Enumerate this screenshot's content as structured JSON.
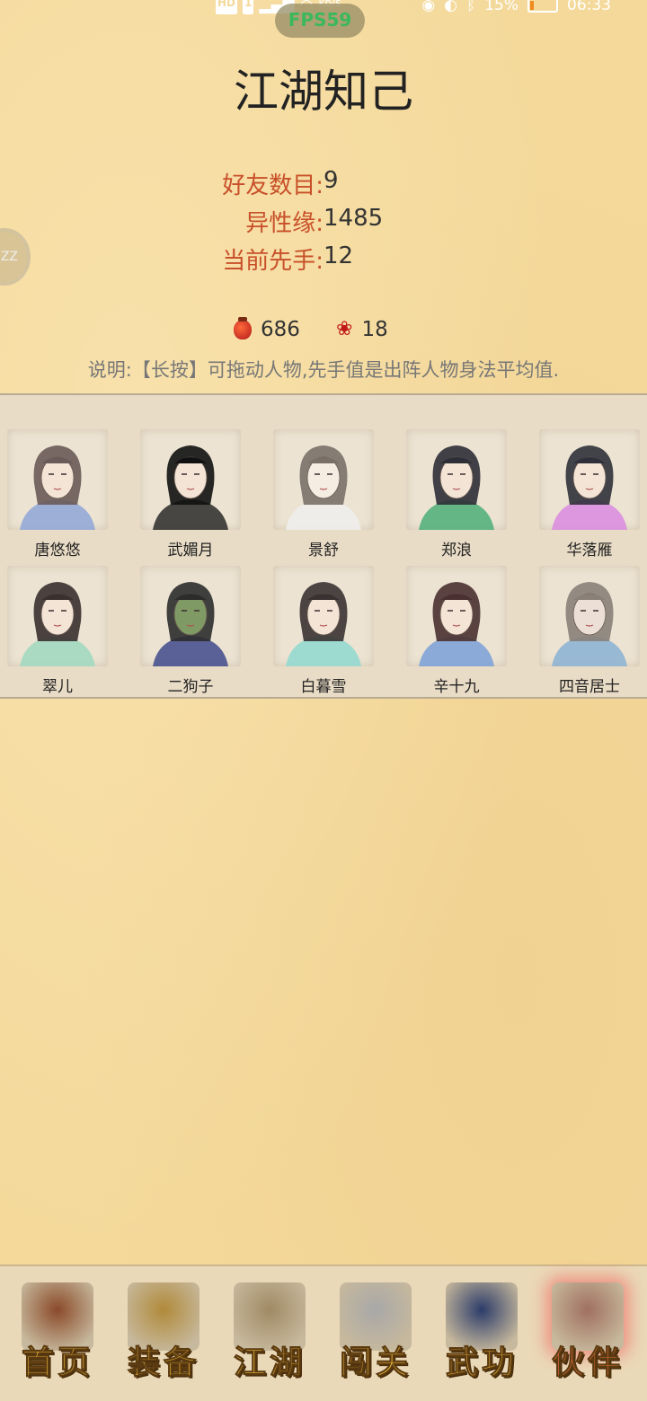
{
  "status_bar": {
    "left_badges": [
      "HD",
      "1"
    ],
    "wifi_label": "kb/s",
    "battery_percent": "15%",
    "battery_level": 0.15,
    "time": "06:33"
  },
  "fps_label": "FPS59",
  "float_ball_label": "ZZ",
  "title": "江湖知己",
  "stats": [
    {
      "label": "好友数目:",
      "value": "9"
    },
    {
      "label": "异性缘:",
      "value": "1485"
    },
    {
      "label": "当前先手:",
      "value": "12"
    }
  ],
  "resources": {
    "jar": {
      "icon": "wine-jar-icon",
      "count": "686"
    },
    "rose": {
      "icon": "rose-icon",
      "count": "18"
    }
  },
  "description": "说明:【长按】可拖动人物,先手值是出阵人物身法平均值.",
  "companions": [
    {
      "name": "唐悠悠",
      "hair": "#6a5a58",
      "robe": "#8fa6d8",
      "skin": "#f3e4d6"
    },
    {
      "name": "武媚月",
      "hair": "#111111",
      "robe": "#2a2a2a",
      "skin": "#f3e4d6"
    },
    {
      "name": "景舒",
      "hair": "#7a7068",
      "robe": "#eeeeee",
      "skin": "#f5ece2"
    },
    {
      "name": "郑浪",
      "hair": "#2e2e36",
      "robe": "#4caf78",
      "skin": "#f3e4d6"
    },
    {
      "name": "华落雁",
      "hair": "#30303a",
      "robe": "#d98ae0",
      "skin": "#f3e4d6"
    },
    {
      "name": "翠儿",
      "hair": "#3a3030",
      "robe": "#9fd8c0",
      "skin": "#f3e4d6"
    },
    {
      "name": "二狗子",
      "hair": "#2c2c2c",
      "robe": "#3f4a8c",
      "skin": "#7f9a64"
    },
    {
      "name": "白暮雪",
      "hair": "#3a3232",
      "robe": "#8fd8d0",
      "skin": "#f3e4d6"
    },
    {
      "name": "辛十九",
      "hair": "#4a3030",
      "robe": "#7aa0d8",
      "skin": "#f3e4d6"
    },
    {
      "name": "四音居士",
      "hair": "#8a8078",
      "robe": "#8ab2d4",
      "skin": "#ece0d6"
    }
  ],
  "bottom_nav": [
    {
      "label": "首页",
      "icon": "pavilion-icon",
      "art": "#8a4a2a",
      "active": false
    },
    {
      "label": "装备",
      "icon": "armor-icon",
      "art": "#b08a3a",
      "active": false
    },
    {
      "label": "江湖",
      "icon": "scroll-map-icon",
      "art": "#a08a64",
      "active": false
    },
    {
      "label": "闯关",
      "icon": "crossed-swords-icon",
      "art": "#a8a8a8",
      "active": false
    },
    {
      "label": "武功",
      "icon": "martial-book-icon",
      "art": "#2c3c6a",
      "active": false
    },
    {
      "label": "伙伴",
      "icon": "companions-icon",
      "art": "#a07060",
      "active": true
    }
  ]
}
